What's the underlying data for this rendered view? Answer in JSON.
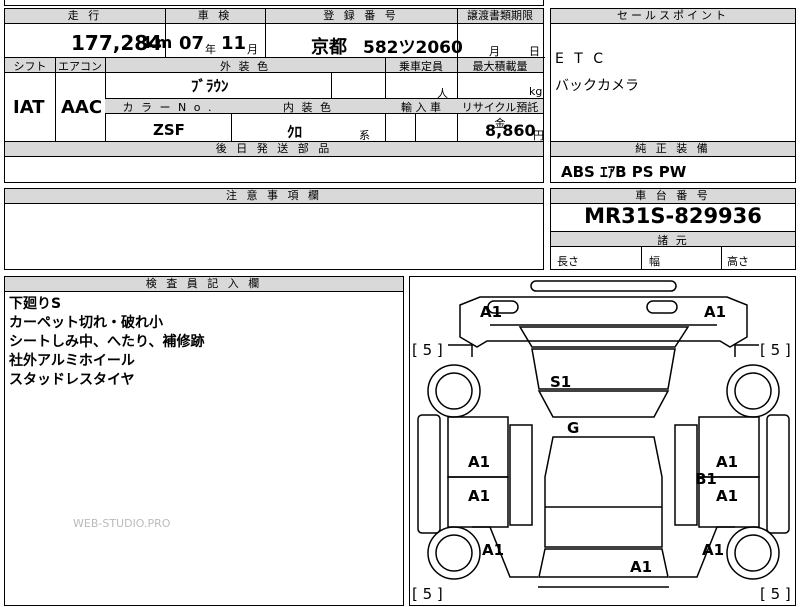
{
  "top_header": {
    "mileage_label": "走 行",
    "inspection_label": "車 検",
    "reg_label": "登 録 番 号",
    "transfer_label": "譲渡書類期限"
  },
  "mileage": {
    "value": "177,284",
    "unit": "km"
  },
  "inspection": {
    "year": "07",
    "year_unit": "年",
    "month": "11",
    "month_unit": "月"
  },
  "registration": {
    "area": "京都",
    "number": "582ツ2060"
  },
  "transfer_deadline": {
    "month_unit": "月",
    "day_unit": "日"
  },
  "row2": {
    "shift_label": "シフト",
    "aircon_label": "エアコン",
    "ext_color_label": "外 装 色",
    "capacity_label": "乗車定員",
    "max_load_label": "最大積載量"
  },
  "shift": "IAT",
  "aircon": "AAC",
  "ext_color": "ﾌﾞﾗｳﾝ",
  "capacity_unit": "人",
  "max_load_unit": "kg",
  "row3": {
    "color_no_label": "カ ラ ー N o .",
    "int_color_label": "内 装 色",
    "import_label": "輸 入 車",
    "recycle_label": "リサイクル預託金"
  },
  "color_no": "ZSF",
  "int_color": "ｸﾛ",
  "int_color_suffix": "系",
  "recycle": {
    "value": "8,860",
    "unit": "円"
  },
  "later_parts_label": "後 日 発 送 部 品",
  "sales_points": {
    "label": "セールスポイント",
    "items": [
      "E T C",
      "バックカメラ"
    ]
  },
  "standard_equip": {
    "label": "純 正 装 備",
    "value": "ABS ｴｱB PS PW"
  },
  "notes_label": "注 意 事 項 欄",
  "chassis": {
    "label": "車 台 番 号",
    "value": "MR31S-829936"
  },
  "dimensions": {
    "label": "諸 元",
    "length": "長さ",
    "width": "幅",
    "height": "高さ"
  },
  "inspector": {
    "label": "検 査 員 記 入 欄",
    "lines": [
      "下廻りS",
      "カーペット切れ・破れ小",
      "シートしみ中、へたり、補修跡",
      "社外アルミホイール",
      "スタッドレスタイヤ"
    ]
  },
  "watermark": "WEB-STUDIO.PRO",
  "diagram": {
    "marks": [
      "A1",
      "A1",
      "S1",
      "G",
      "A1",
      "A1",
      "B1",
      "A1",
      "A1",
      "A1",
      "A1",
      "A1",
      "A1"
    ],
    "tire": "[ 5 ]"
  }
}
